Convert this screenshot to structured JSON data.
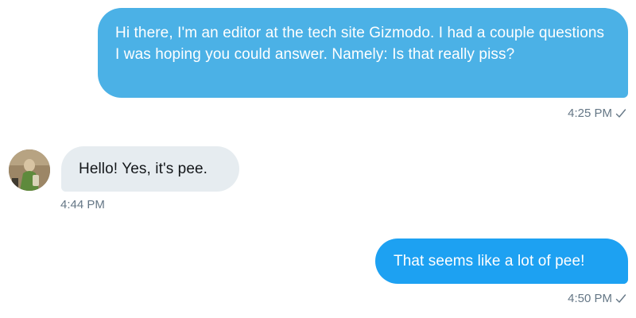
{
  "conversation": {
    "messages": [
      {
        "direction": "outgoing",
        "text": "Hi there, I'm an editor at the tech site Gizmodo. I had a couple questions I was hoping you could answer. Namely: Is that really piss?",
        "time": "4:25 PM",
        "status_icon": "checkmark-icon"
      },
      {
        "direction": "incoming",
        "text": "Hello! Yes, it's pee.",
        "time": "4:44 PM",
        "avatar": "avatar-photo"
      },
      {
        "direction": "outgoing",
        "text": "That seems like a lot of pee!",
        "time": "4:50 PM",
        "status_icon": "checkmark-icon"
      }
    ]
  },
  "colors": {
    "outgoing_bubble_1": "#4bb1e6",
    "outgoing_bubble_2": "#1da1f2",
    "incoming_bubble": "#e6ecf0",
    "meta_text": "#657786",
    "incoming_text": "#14171a",
    "outgoing_text": "#ffffff"
  }
}
